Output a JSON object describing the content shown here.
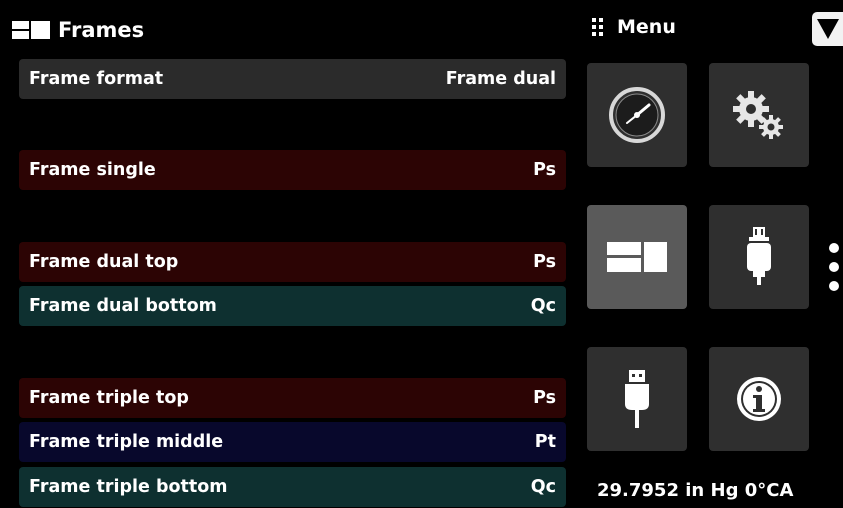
{
  "header": {
    "title": "Frames",
    "title_icon": "frames-icon"
  },
  "menu": {
    "title": "Menu",
    "title_icon": "grid-icon",
    "dropdown_icon": "triangle-down-icon"
  },
  "rows": [
    {
      "label": "Frame format",
      "value": "Frame dual",
      "color": "#2b2b2b"
    },
    {
      "label": "Frame single",
      "value": "Ps",
      "color": "#2c0404"
    },
    {
      "label": "Frame dual top",
      "value": "Ps",
      "color": "#2c0404"
    },
    {
      "label": "Frame dual bottom",
      "value": "Qc",
      "color": "#0e3030"
    },
    {
      "label": "Frame triple top",
      "value": "Ps",
      "color": "#2c0404"
    },
    {
      "label": "Frame triple middle",
      "value": "Pt",
      "color": "#08082c"
    },
    {
      "label": "Frame triple bottom",
      "value": "Qc",
      "color": "#0e3030"
    }
  ],
  "tiles": [
    {
      "icon": "gauge-icon",
      "active": false
    },
    {
      "icon": "gears-icon",
      "active": false
    },
    {
      "icon": "frames-icon",
      "active": true
    },
    {
      "icon": "sensor-icon",
      "active": false
    },
    {
      "icon": "usb-icon",
      "active": false
    },
    {
      "icon": "info-icon",
      "active": false
    }
  ],
  "pagination": {
    "pages": 3
  },
  "status": {
    "reading": "29.7952 in Hg 0°CA"
  }
}
